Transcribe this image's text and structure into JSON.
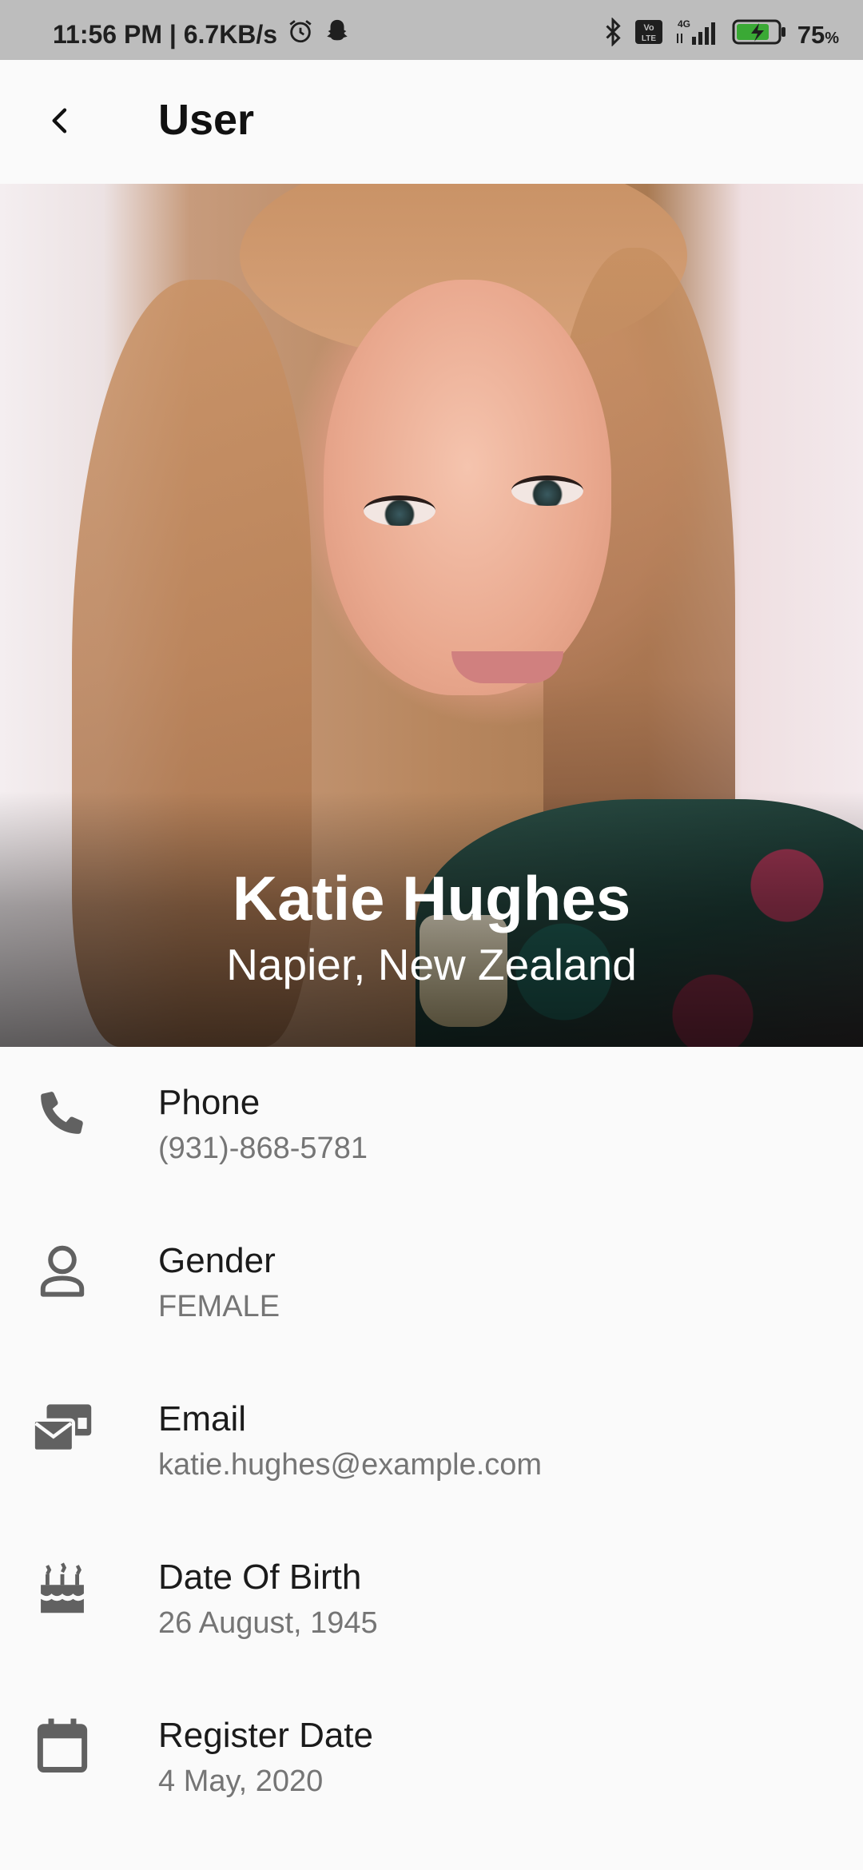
{
  "status_bar": {
    "time_and_speed": "11:56 PM | 6.7KB/s",
    "network_type": "4G",
    "volte": "Vo LTE",
    "battery_percent": "75",
    "battery_suffix": "%"
  },
  "app_bar": {
    "title": "User",
    "back_icon": "chevron-left-icon"
  },
  "profile": {
    "name": "Katie Hughes",
    "location": "Napier, New Zealand"
  },
  "details": [
    {
      "icon": "phone-icon",
      "label": "Phone",
      "value": "(931)-868-5781"
    },
    {
      "icon": "person-icon",
      "label": "Gender",
      "value": "FEMALE"
    },
    {
      "icon": "email-icon",
      "label": "Email",
      "value": "katie.hughes@example.com"
    },
    {
      "icon": "cake-icon",
      "label": "Date Of Birth",
      "value": "26 August, 1945"
    },
    {
      "icon": "calendar-icon",
      "label": "Register Date",
      "value": "4 May, 2020"
    }
  ],
  "colors": {
    "status_bar_bg": "#bdbdbd",
    "page_bg": "#fafafa",
    "icon": "#616161",
    "label": "#1b1b1b",
    "value": "#757575"
  }
}
